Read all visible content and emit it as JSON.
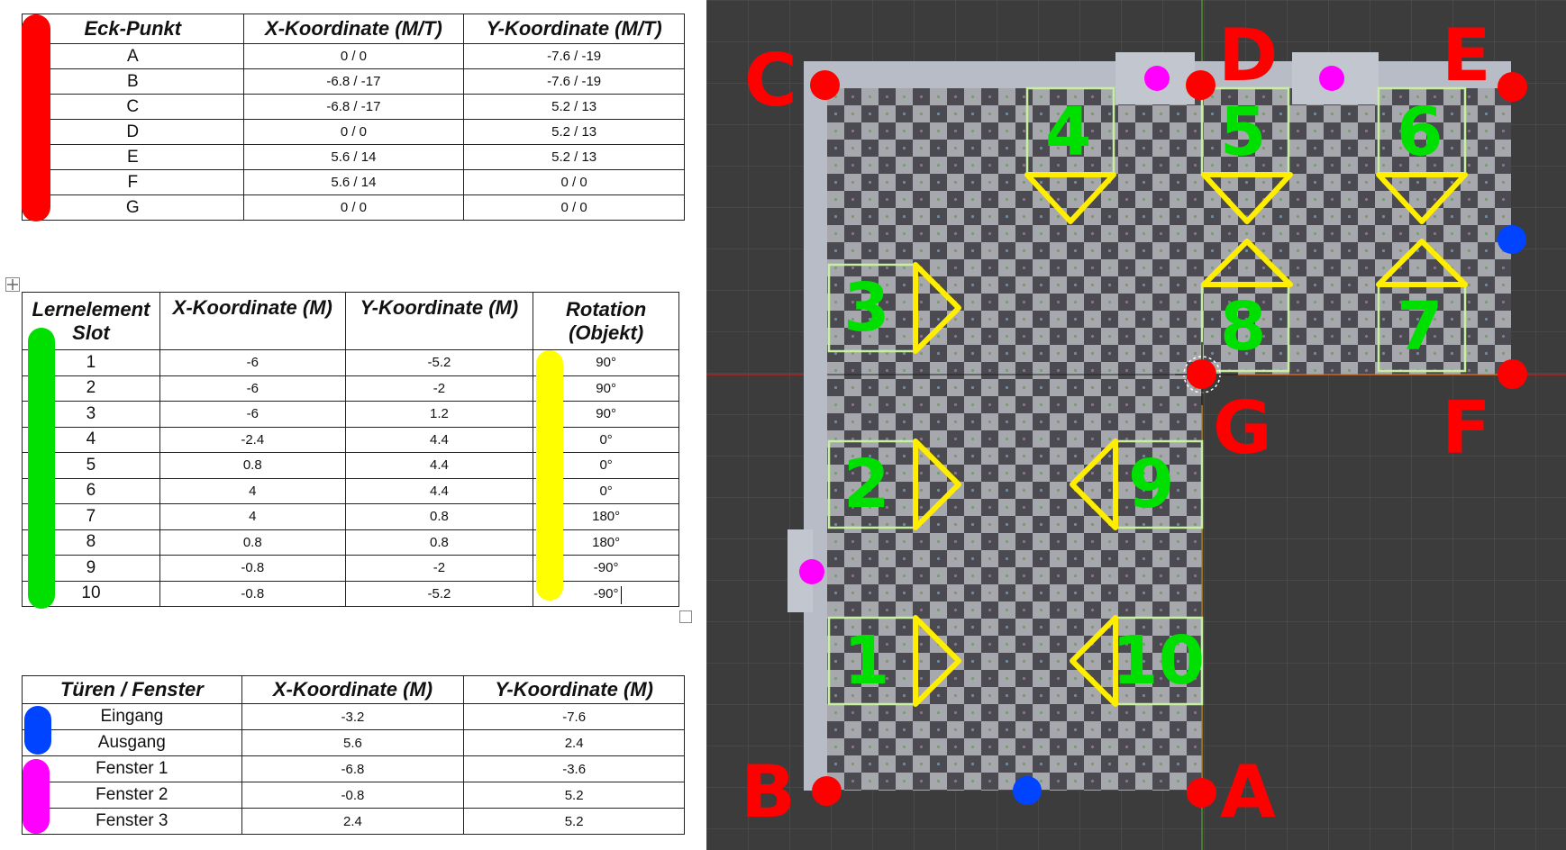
{
  "corners_table": {
    "headers": [
      "Eck-Punkt",
      "X-Koordinate (M/T)",
      "Y-Koordinate (M/T)"
    ],
    "rows": [
      [
        "A",
        "0 / 0",
        "-7.6 / -19"
      ],
      [
        "B",
        "-6.8 / -17",
        "-7.6 / -19"
      ],
      [
        "C",
        "-6.8 / -17",
        "5.2 / 13"
      ],
      [
        "D",
        "0 / 0",
        "5.2 / 13"
      ],
      [
        "E",
        "5.6 / 14",
        "5.2 / 13"
      ],
      [
        "F",
        "5.6 / 14",
        "0 / 0"
      ],
      [
        "G",
        "0 / 0",
        "0 / 0"
      ]
    ]
  },
  "slots_table": {
    "headers": [
      "Lernelement Slot",
      "X-Koordinate (M)",
      "Y-Koordinate (M)",
      "Rotation (Objekt)"
    ],
    "rows": [
      [
        "1",
        "-6",
        "-5.2",
        "90°"
      ],
      [
        "2",
        "-6",
        "-2",
        "90°"
      ],
      [
        "3",
        "-6",
        "1.2",
        "90°"
      ],
      [
        "4",
        "-2.4",
        "4.4",
        "0°"
      ],
      [
        "5",
        "0.8",
        "4.4",
        "0°"
      ],
      [
        "6",
        "4",
        "4.4",
        "0°"
      ],
      [
        "7",
        "4",
        "0.8",
        "180°"
      ],
      [
        "8",
        "0.8",
        "0.8",
        "180°"
      ],
      [
        "9",
        "-0.8",
        "-2",
        "-90°"
      ],
      [
        "10",
        "-0.8",
        "-5.2",
        "-90°"
      ]
    ]
  },
  "doors_table": {
    "headers": [
      "Türen / Fenster",
      "X-Koordinate (M)",
      "Y-Koordinate (M)"
    ],
    "rows": [
      [
        "Eingang",
        "-3.2",
        "-7.6"
      ],
      [
        "Ausgang",
        "5.6",
        "2.4"
      ],
      [
        "Fenster 1",
        "-6.8",
        "-3.6"
      ],
      [
        "Fenster 2",
        "-0.8",
        "5.2"
      ],
      [
        "Fenster 3",
        "2.4",
        "5.2"
      ]
    ]
  },
  "viewport": {
    "corner_letters": {
      "A": "A",
      "B": "B",
      "C": "C",
      "D": "D",
      "E": "E",
      "F": "F",
      "G": "G"
    },
    "slot_numbers": [
      "1",
      "2",
      "3",
      "4",
      "5",
      "6",
      "7",
      "8",
      "9",
      "10"
    ]
  },
  "colors": {
    "corner": "#ff0000",
    "slot": "#00e000",
    "rotation": "#ffff00",
    "door": "#0044ff",
    "window": "#ff00ff",
    "viewport_bg": "#3c3c3c"
  }
}
